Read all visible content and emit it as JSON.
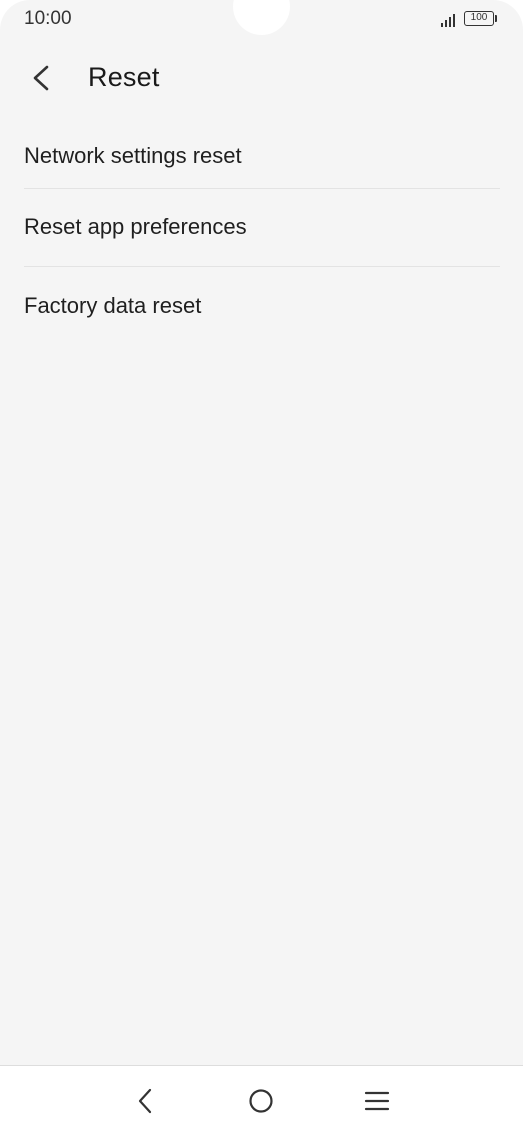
{
  "status_bar": {
    "time": "10:00",
    "battery": "100"
  },
  "header": {
    "title": "Reset",
    "back_icon": "chevron-left-icon"
  },
  "menu": {
    "items": [
      {
        "label": "Network settings reset"
      },
      {
        "label": "Reset app preferences"
      },
      {
        "label": "Factory data reset"
      }
    ]
  },
  "nav_bar": {
    "back_icon": "nav-back-icon",
    "home_icon": "nav-home-icon",
    "menu_icon": "nav-menu-icon"
  },
  "colors": {
    "background": "#f5f5f5",
    "text": "#1f1f1f",
    "divider": "#e3e3e3"
  }
}
